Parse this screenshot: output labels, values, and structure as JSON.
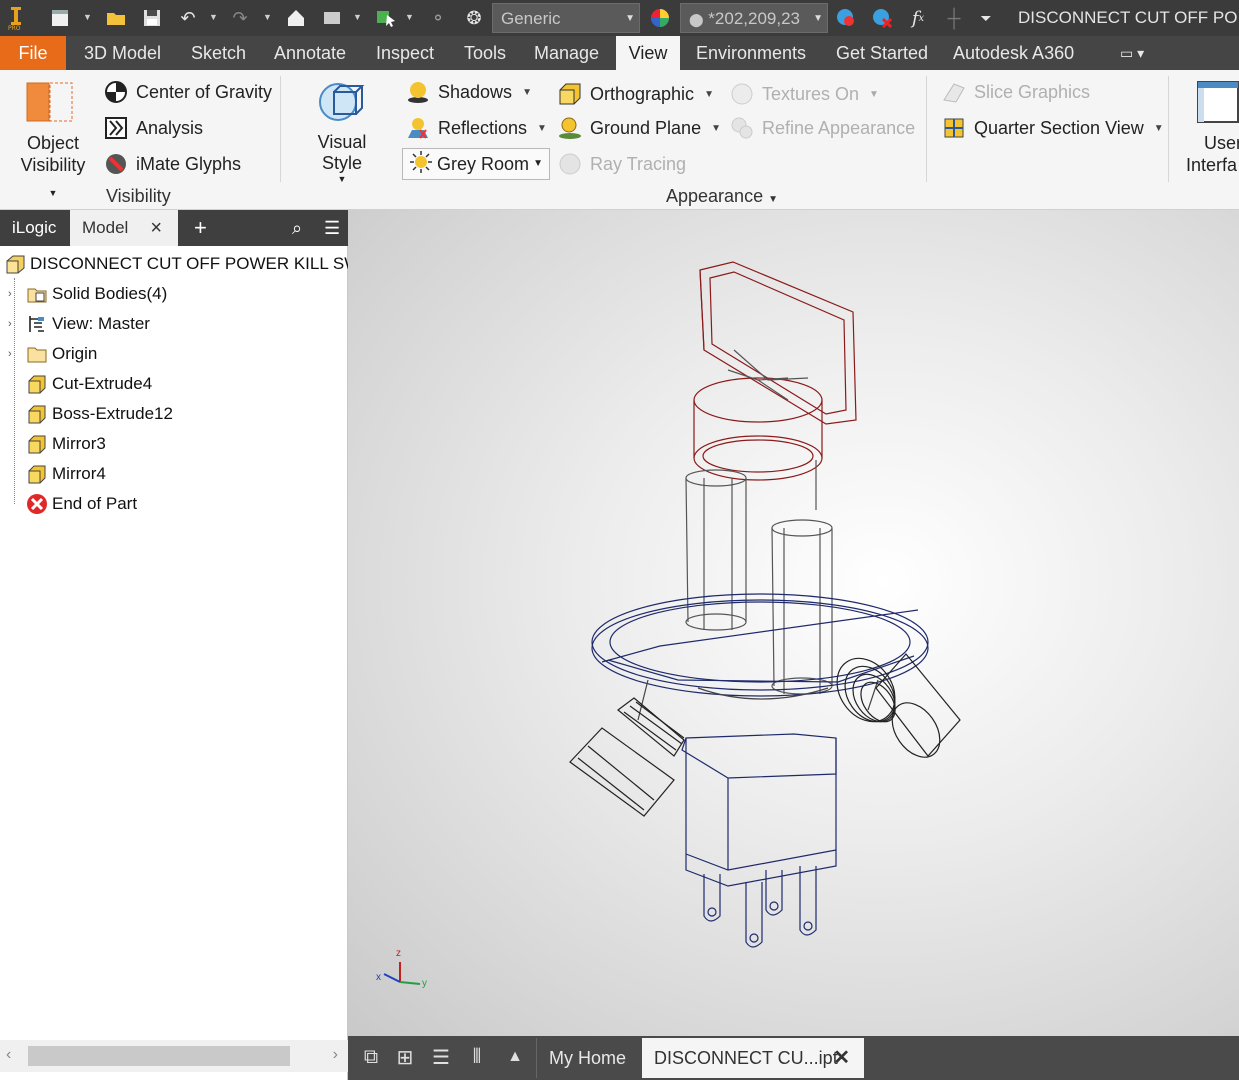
{
  "quick_access": {
    "material": "Generic",
    "color": "*202,209,23",
    "title": "DISCONNECT CUT OFF PO..."
  },
  "tabs": [
    "File",
    "3D Model",
    "Sketch",
    "Annotate",
    "Inspect",
    "Tools",
    "Manage",
    "View",
    "Environments",
    "Get Started",
    "Autodesk A360"
  ],
  "active_tab": "View",
  "ribbon": {
    "visibility": {
      "object_visibility_line1": "Object",
      "object_visibility_line2": "Visibility",
      "center_of_gravity": "Center of Gravity",
      "analysis": "Analysis",
      "imate_glyphs": "iMate Glyphs",
      "label": "Visibility"
    },
    "appearance": {
      "visual_style_line1": "Visual Style",
      "shadows": "Shadows",
      "reflections": "Reflections",
      "lighting_style": "Grey Room",
      "orthographic": "Orthographic",
      "ground_plane": "Ground Plane",
      "ray_tracing": "Ray Tracing",
      "textures_on": "Textures On",
      "refine_appearance": "Refine Appearance",
      "label": "Appearance"
    },
    "section": {
      "slice_graphics": "Slice Graphics",
      "quarter_section_view": "Quarter Section View"
    },
    "windows": {
      "user_interface_line1": "User",
      "user_interface_line2": "Interfa"
    }
  },
  "browser": {
    "tabs": [
      "iLogic",
      "Model"
    ],
    "root": "DISCONNECT CUT OFF POWER KILL SWITC",
    "items": [
      {
        "label": "Solid Bodies(4)",
        "icon": "solid-bodies-icon"
      },
      {
        "label": "View: Master",
        "icon": "view-icon"
      },
      {
        "label": "Origin",
        "icon": "folder-icon"
      },
      {
        "label": "Cut-Extrude4",
        "icon": "feature-icon"
      },
      {
        "label": "Boss-Extrude12",
        "icon": "feature-icon"
      },
      {
        "label": "Mirror3",
        "icon": "feature-icon"
      },
      {
        "label": "Mirror4",
        "icon": "feature-icon"
      },
      {
        "label": "End of Part",
        "icon": "end-of-part-icon"
      }
    ]
  },
  "bottom": {
    "my_home": "My Home",
    "document_tab": "DISCONNECT CU...ipt"
  },
  "triad": {
    "x": "x",
    "y": "y",
    "z": "z"
  },
  "colors": {
    "file_tab": "#e86b1a",
    "title_bar": "#3b3b3b",
    "wire_blue": "#1f2a6b",
    "wire_red": "#8b1a1a"
  }
}
